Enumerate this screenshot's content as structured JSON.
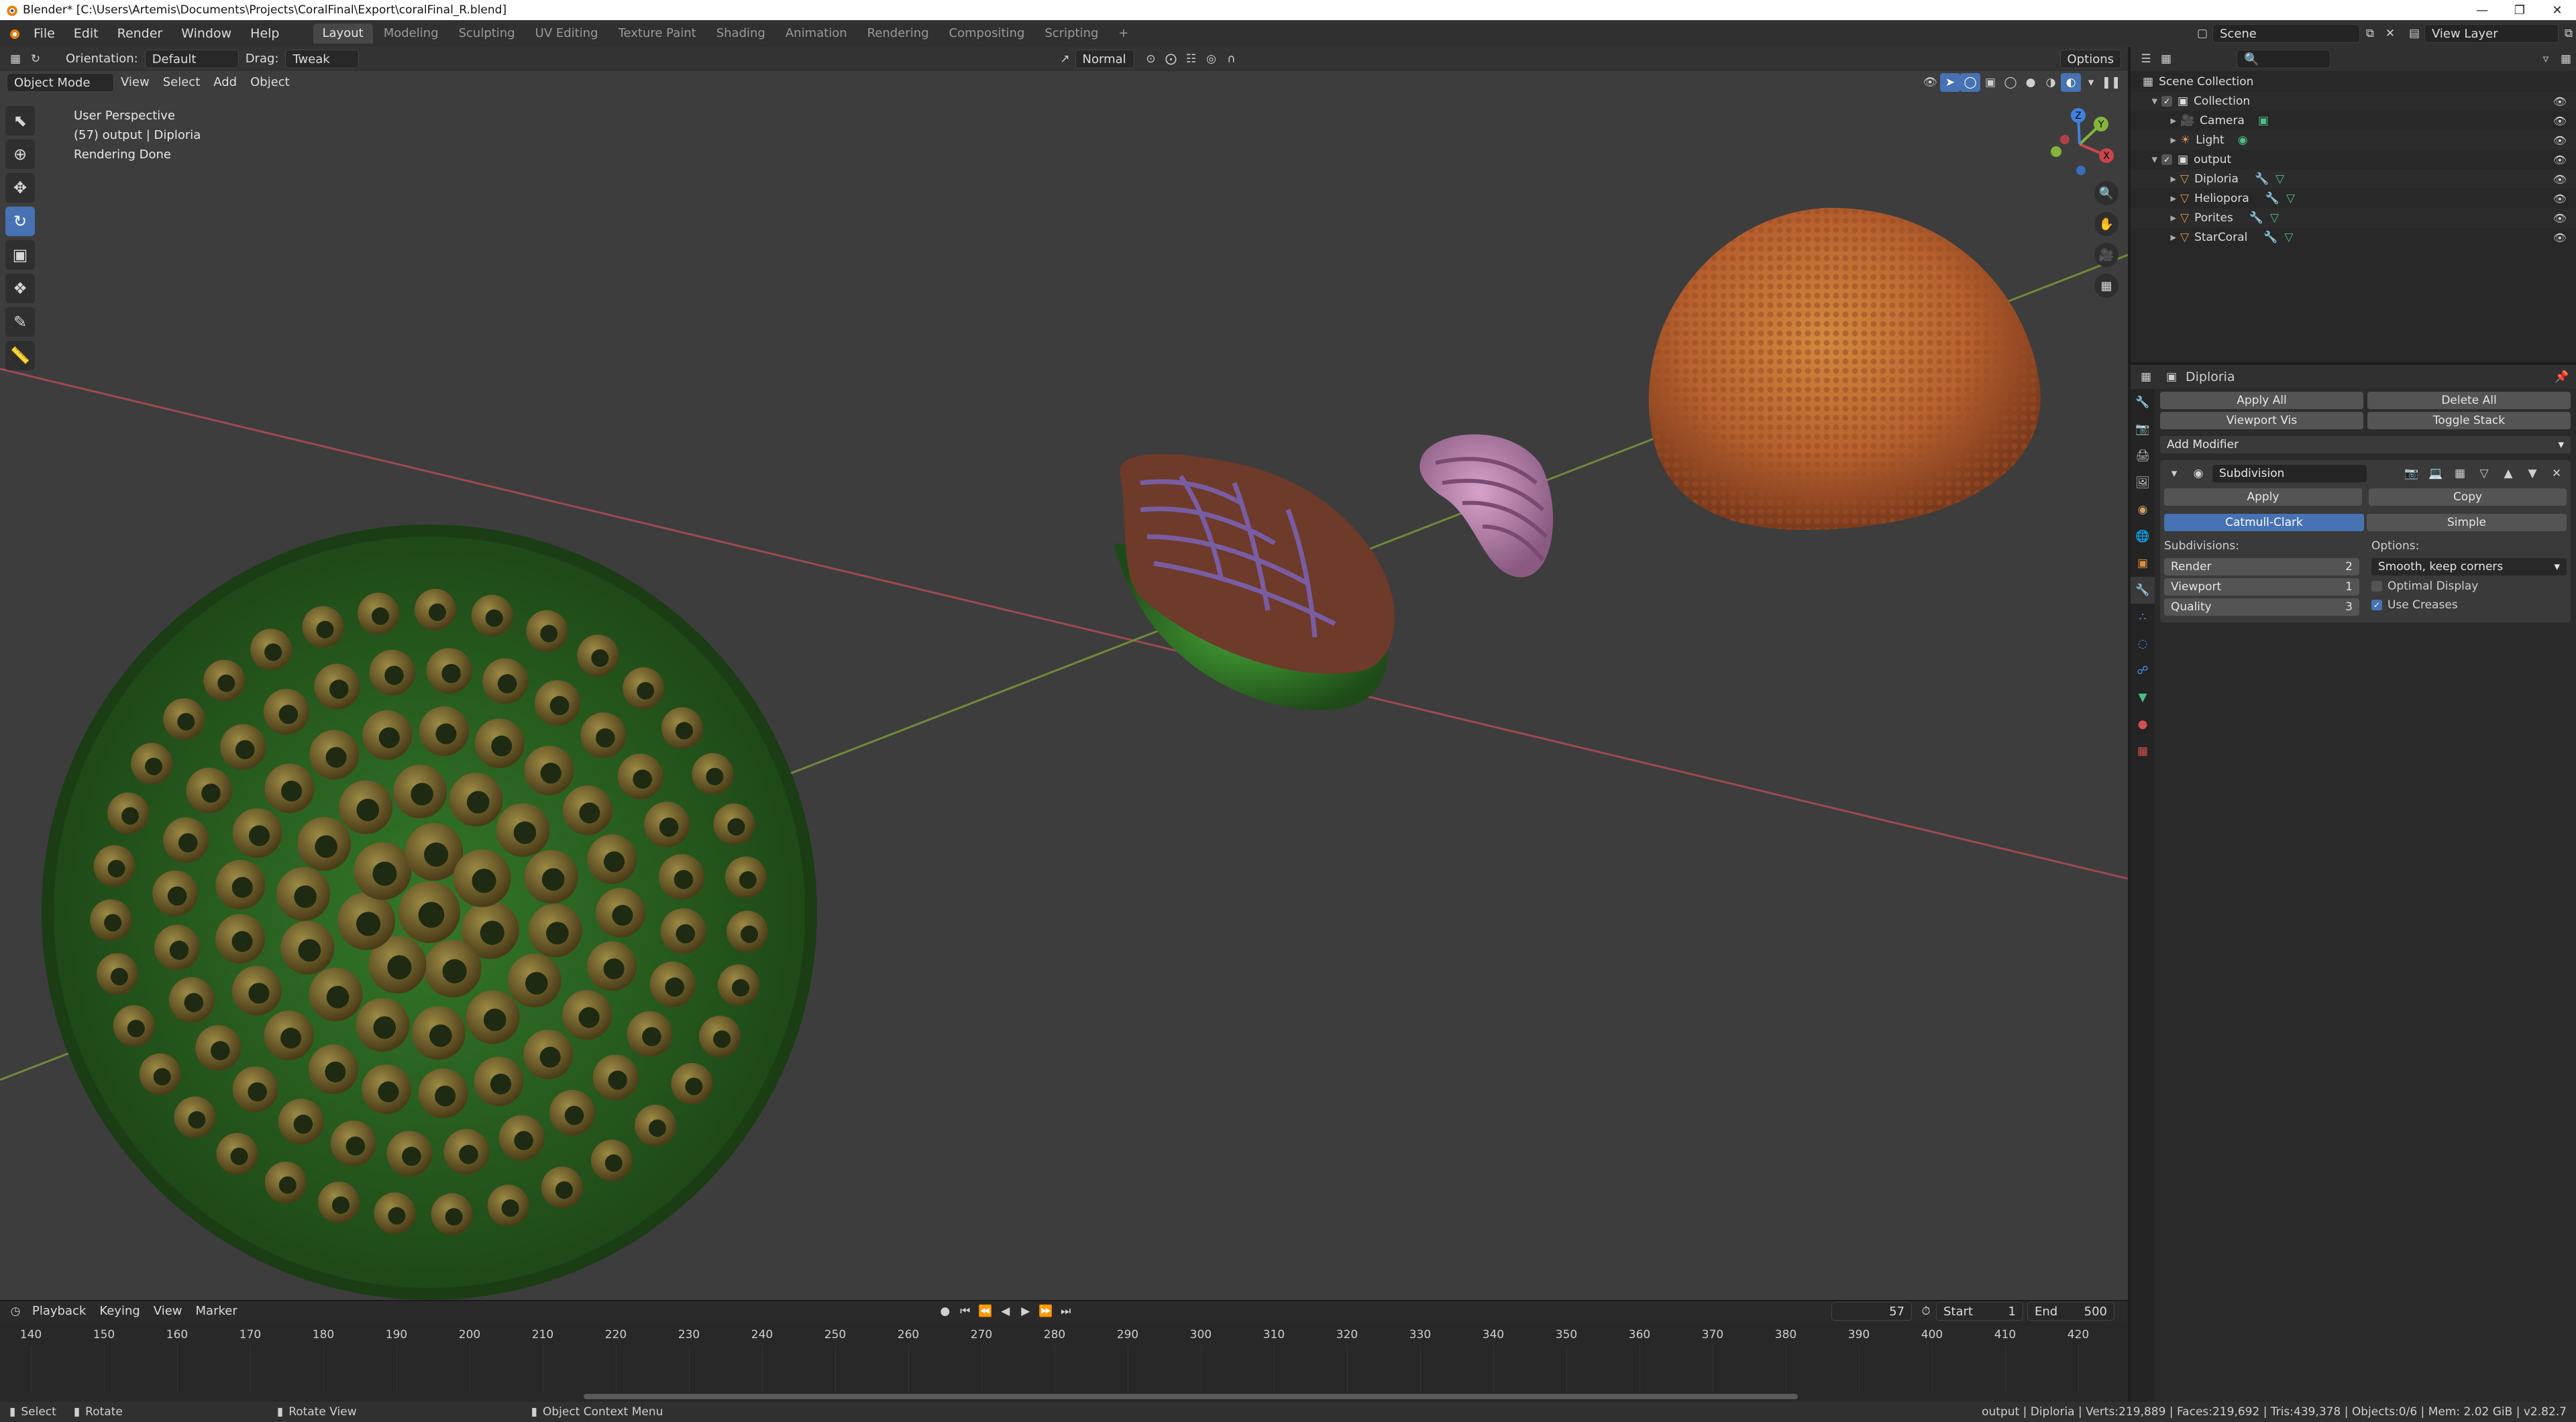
{
  "titlebar": {
    "title": "Blender* [C:\\Users\\Artemis\\Documents\\Projects\\CoralFinal\\Export\\coralFinal_R.blend]"
  },
  "menu": [
    "File",
    "Edit",
    "Render",
    "Window",
    "Help"
  ],
  "workspaces": [
    "Layout",
    "Modeling",
    "Sculpting",
    "UV Editing",
    "Texture Paint",
    "Shading",
    "Animation",
    "Rendering",
    "Compositing",
    "Scripting"
  ],
  "scene": {
    "name": "Scene",
    "view_layer": "View Layer"
  },
  "viewport": {
    "orientation_label": "Orientation:",
    "orientation_value": "Default",
    "drag_label": "Drag:",
    "drag_value": "Tweak",
    "pivot_value": "Normal",
    "options_label": "Options",
    "mode": "Object Mode",
    "header_menus": [
      "View",
      "Select",
      "Add",
      "Object"
    ],
    "info": [
      "User Perspective",
      "(57) output | Diploria",
      "Rendering Done"
    ],
    "gizmo_axes": [
      "X",
      "Y",
      "Z"
    ]
  },
  "timeline": {
    "menus": [
      "Playback",
      "Keying",
      "View",
      "Marker"
    ],
    "current_frame": "57",
    "start_label": "Start",
    "start_value": "1",
    "end_label": "End",
    "end_value": "500",
    "ruler_ticks": [
      "140",
      "150",
      "160",
      "170",
      "180",
      "190",
      "200",
      "210",
      "220",
      "230",
      "240",
      "250",
      "260",
      "270",
      "280",
      "290",
      "300",
      "310",
      "320",
      "330",
      "340",
      "350",
      "360",
      "370",
      "380",
      "390",
      "400",
      "410",
      "420"
    ]
  },
  "statusbar": {
    "select": "Select",
    "rotate": "Rotate",
    "rotate_view": "Rotate View",
    "context_menu": "Object Context Menu",
    "stats": "output | Diploria | Verts:219,889 | Faces:219,692 | Tris:439,378 | Objects:0/6 | Mem: 2.02 GiB | v2.82.7"
  },
  "outliner": {
    "rows": [
      {
        "label": "Scene Collection",
        "indent": 0,
        "kind": "scene"
      },
      {
        "label": "Collection",
        "indent": 1,
        "kind": "collection"
      },
      {
        "label": "Camera",
        "indent": 2,
        "kind": "camera"
      },
      {
        "label": "Light",
        "indent": 2,
        "kind": "light"
      },
      {
        "label": "output",
        "indent": 1,
        "kind": "collection"
      },
      {
        "label": "Diploria",
        "indent": 2,
        "kind": "mesh"
      },
      {
        "label": "Heliopora",
        "indent": 2,
        "kind": "mesh"
      },
      {
        "label": "Porites",
        "indent": 2,
        "kind": "mesh"
      },
      {
        "label": "StarCoral",
        "indent": 2,
        "kind": "mesh"
      }
    ]
  },
  "properties": {
    "object_name": "Diploria",
    "apply_all": "Apply All",
    "delete_all": "Delete All",
    "viewport_vis": "Viewport Vis",
    "toggle_stack": "Toggle Stack",
    "add_modifier": "Add Modifier",
    "modifier_name": "Subdivision",
    "apply": "Apply",
    "copy": "Copy",
    "catmull_clark": "Catmull-Clark",
    "simple": "Simple",
    "subdivisions_label": "Subdivisions:",
    "options_label": "Options:",
    "render_label": "Render",
    "render_value": "2",
    "viewport_label": "Viewport",
    "viewport_value": "1",
    "quality_label": "Quality",
    "quality_value": "3",
    "uv_smooth": "Smooth, keep corners",
    "optimal_display": "Optimal Display",
    "optimal_display_checked": false,
    "use_creases": "Use Creases",
    "use_creases_checked": true
  },
  "colors": {
    "accent": "#4772b3",
    "x_axis": "#c8464c",
    "y_axis": "#84b53a",
    "z_axis": "#3f82e0"
  }
}
